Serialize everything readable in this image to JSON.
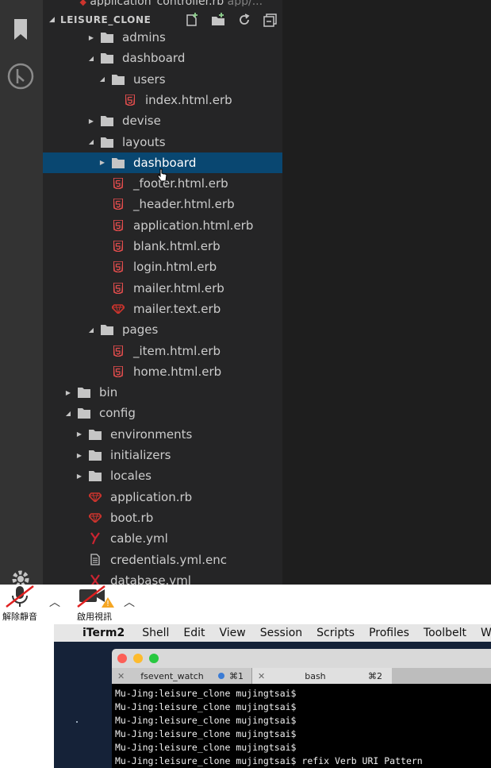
{
  "explorer": {
    "top_file_name": "application_controller.rb",
    "top_file_path": "app/...",
    "section_title": "LEISURE_CLONE",
    "tree": [
      {
        "label": "admins",
        "type": "folder",
        "depth": 2,
        "expanded": false
      },
      {
        "label": "dashboard",
        "type": "folder",
        "depth": 2,
        "expanded": true
      },
      {
        "label": "users",
        "type": "folder",
        "depth": 3,
        "expanded": true
      },
      {
        "label": "index.html.erb",
        "type": "html",
        "depth": 4
      },
      {
        "label": "devise",
        "type": "folder",
        "depth": 2,
        "expanded": false
      },
      {
        "label": "layouts",
        "type": "folder",
        "depth": 2,
        "expanded": true
      },
      {
        "label": "dashboard",
        "type": "folder",
        "depth": 3,
        "expanded": false,
        "selected": true
      },
      {
        "label": "_footer.html.erb",
        "type": "html",
        "depth": 3
      },
      {
        "label": "_header.html.erb",
        "type": "html",
        "depth": 3
      },
      {
        "label": "application.html.erb",
        "type": "html",
        "depth": 3
      },
      {
        "label": "blank.html.erb",
        "type": "html",
        "depth": 3
      },
      {
        "label": "login.html.erb",
        "type": "html",
        "depth": 3
      },
      {
        "label": "mailer.html.erb",
        "type": "html",
        "depth": 3
      },
      {
        "label": "mailer.text.erb",
        "type": "ruby",
        "depth": 3
      },
      {
        "label": "pages",
        "type": "folder",
        "depth": 2,
        "expanded": true
      },
      {
        "label": "_item.html.erb",
        "type": "html",
        "depth": 3
      },
      {
        "label": "home.html.erb",
        "type": "html",
        "depth": 3
      },
      {
        "label": "bin",
        "type": "folder",
        "depth": 0,
        "expanded": false
      },
      {
        "label": "config",
        "type": "folder",
        "depth": 0,
        "expanded": true
      },
      {
        "label": "environments",
        "type": "folder",
        "depth": 1,
        "expanded": false
      },
      {
        "label": "initializers",
        "type": "folder",
        "depth": 1,
        "expanded": false
      },
      {
        "label": "locales",
        "type": "folder",
        "depth": 1,
        "expanded": false
      },
      {
        "label": "application.rb",
        "type": "ruby",
        "depth": 1
      },
      {
        "label": "boot.rb",
        "type": "ruby",
        "depth": 1
      },
      {
        "label": "cable.yml",
        "type": "yaml",
        "depth": 1
      },
      {
        "label": "credentials.yml.enc",
        "type": "text",
        "depth": 1
      },
      {
        "label": "database.yml",
        "type": "yaml-x",
        "depth": 1
      }
    ]
  },
  "zoom": {
    "unmute_label": "解除靜音",
    "start_video_label": "啟用視訊"
  },
  "mac_menu": {
    "items": [
      "iTerm2",
      "Shell",
      "Edit",
      "View",
      "Session",
      "Scripts",
      "Profiles",
      "Toolbelt",
      "Wi"
    ]
  },
  "iterm": {
    "tabs": [
      {
        "title": "fsevent_watch",
        "shortcut": "⌘1"
      },
      {
        "title": "bash",
        "shortcut": "⌘2"
      }
    ],
    "lines": [
      "Mu-Jing:leisure_clone mujingtsai$",
      "Mu-Jing:leisure_clone mujingtsai$",
      "Mu-Jing:leisure_clone mujingtsai$",
      "Mu-Jing:leisure_clone mujingtsai$",
      "Mu-Jing:leisure_clone mujingtsai$",
      "Mu-Jing:leisure_clone mujingtsai$ refix Verb URI Pattern"
    ]
  },
  "colors": {
    "selection": "#094771",
    "folder_icon": "#c5c5c5",
    "html_icon": "#e44d4d",
    "ruby_icon": "#cc342d",
    "yaml_icon": "#cb2431"
  }
}
